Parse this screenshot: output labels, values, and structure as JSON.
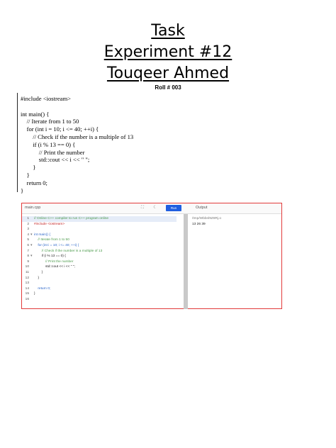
{
  "document": {
    "title_line1": "Task",
    "title_line2": "Experiment #12",
    "title_line3": "Touqeer Ahmed",
    "roll": "Roll # 003",
    "code_lines": [
      "#include <iostream>",
      "",
      "int main() {",
      "    // Iterate from 1 to 50",
      "    for (int i = 10; i <= 40; ++i) {",
      "        // Check if the number is a multiple of 13",
      "        if (i % 13 == 0) {",
      "            // Print the number",
      "            std::cout << i << \" \";",
      "        }",
      "    }",
      "    return 0;",
      "}"
    ]
  },
  "ide": {
    "file_tab": "main.cpp",
    "run_label": "Run",
    "output_label": "Output",
    "output_path": "/tmp/Wbbnl9Z8Rj.o",
    "output_text": "13 26 39",
    "editor_lines": [
      {
        "n": "1",
        "fold": "",
        "text": "// Online C++ compiler to run C++ program online",
        "cls": "ed-comment",
        "hl": true
      },
      {
        "n": "2",
        "fold": "",
        "text": "#include <iostream>",
        "cls": "ed-str",
        "hl": false
      },
      {
        "n": "3",
        "fold": "",
        "text": "",
        "cls": "",
        "hl": false
      },
      {
        "n": "4",
        "fold": "▾",
        "text": "int main() {",
        "cls": "ed-kw",
        "hl": false
      },
      {
        "n": "5",
        "fold": "",
        "text": "    // Iterate from 1 to 50",
        "cls": "ed-comment",
        "hl": false
      },
      {
        "n": "6",
        "fold": "▾",
        "text": "    for (int i = 10; i <= 40; ++i) {",
        "cls": "ed-kw",
        "hl": false
      },
      {
        "n": "7",
        "fold": "",
        "text": "        // Check if the number is a multiple of 13",
        "cls": "ed-comment",
        "hl": false
      },
      {
        "n": "8",
        "fold": "▾",
        "text": "        if (i % 13 == 0) {",
        "cls": "",
        "hl": false
      },
      {
        "n": "9",
        "fold": "",
        "text": "            // Print the number",
        "cls": "ed-comment",
        "hl": false
      },
      {
        "n": "10",
        "fold": "",
        "text": "            std::cout << i << \" \";",
        "cls": "",
        "hl": false
      },
      {
        "n": "11",
        "fold": "",
        "text": "        }",
        "cls": "",
        "hl": false
      },
      {
        "n": "12",
        "fold": "",
        "text": "    }",
        "cls": "",
        "hl": false
      },
      {
        "n": "13",
        "fold": "",
        "text": "",
        "cls": "",
        "hl": false
      },
      {
        "n": "14",
        "fold": "",
        "text": "    return 0;",
        "cls": "ed-kw",
        "hl": false
      },
      {
        "n": "15",
        "fold": "",
        "text": "}",
        "cls": "",
        "hl": false
      },
      {
        "n": "16",
        "fold": "",
        "text": "",
        "cls": "",
        "hl": false
      }
    ]
  }
}
